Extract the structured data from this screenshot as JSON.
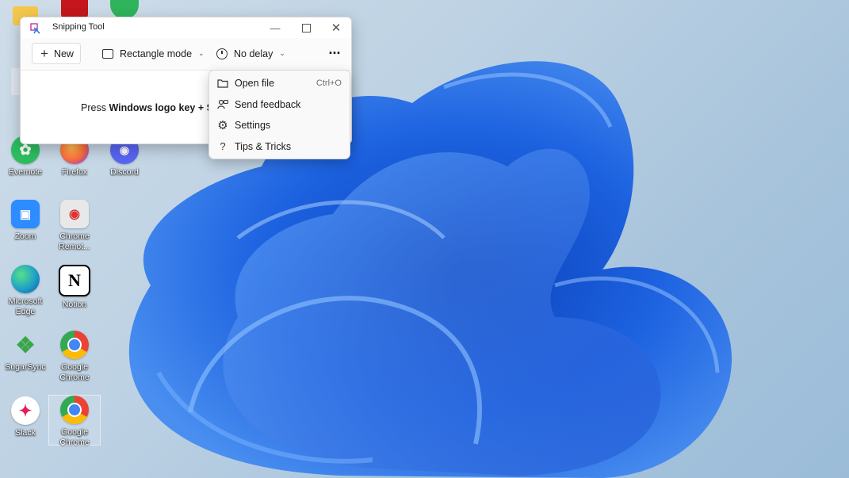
{
  "desktop": {
    "icons": [
      {
        "label": "Evernote",
        "icon": "evernote-icon",
        "color": "#2dbe60"
      },
      {
        "label": "Firefox",
        "icon": "firefox-icon",
        "color": "#ff7139"
      },
      {
        "label": "Discord",
        "icon": "discord-icon",
        "color": "#5865f2"
      },
      {
        "label": "Zoom",
        "icon": "zoom-icon",
        "color": "#2d8cff"
      },
      {
        "label": "Chrome Remot...",
        "icon": "chrome-remote-icon",
        "color": "#dadada"
      },
      {
        "label": "Microsoft Edge",
        "icon": "edge-icon",
        "color": "#1fa0c8"
      },
      {
        "label": "Notion",
        "icon": "notion-icon",
        "color": "#ffffff"
      },
      {
        "label": "SugarSync",
        "icon": "sugarsync-icon",
        "color": "#3aa64a"
      },
      {
        "label": "Google Chrome",
        "icon": "chrome-icon",
        "color": "#4285f4"
      },
      {
        "label": "Slack",
        "icon": "slack-icon",
        "color": "#ffffff"
      },
      {
        "label": "Google Chrome",
        "icon": "chrome-icon",
        "color": "#4285f4"
      }
    ]
  },
  "snipping_tool": {
    "title": "Snipping Tool",
    "toolbar": {
      "new_label": "New",
      "mode_label": "Rectangle mode",
      "delay_label": "No delay"
    },
    "hint_prefix": "Press ",
    "hint_bold": "Windows logo key + Shif",
    "menu": {
      "items": [
        {
          "label": "Open file",
          "shortcut": "Ctrl+O",
          "icon": "folder-icon"
        },
        {
          "label": "Send feedback",
          "shortcut": "",
          "icon": "feedback-icon"
        },
        {
          "label": "Settings",
          "shortcut": "",
          "icon": "gear-icon"
        },
        {
          "label": "Tips & Tricks",
          "shortcut": "",
          "icon": "question-icon"
        }
      ]
    }
  },
  "colors": {
    "wallpaper_blue": "#1e5bd8",
    "window_bg": "#ffffff",
    "menu_bg": "#f9f9f9"
  }
}
